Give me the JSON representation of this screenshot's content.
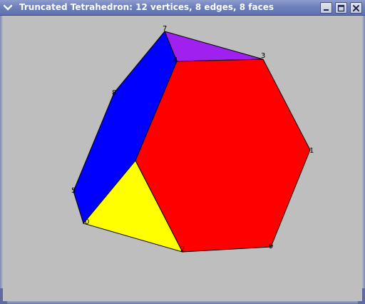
{
  "window": {
    "title": "Truncated Tetrahedron: 12 vertices, 8 edges, 8 faces",
    "menu_icon": "chevron-down-icon",
    "controls": {
      "minimize_icon": "minimize-icon",
      "maximize_icon": "maximize-icon",
      "close_icon": "close-icon"
    }
  },
  "colors": {
    "background": "#bebebe",
    "face_red": "#ff0000",
    "face_blue": "#0000ff",
    "face_yellow": "#ffff00",
    "face_purple": "#a020f0",
    "edge": "#000000"
  },
  "polyhedron": {
    "faces": [
      {
        "name": "purple-face",
        "color": "#a020f0"
      },
      {
        "name": "blue-face",
        "color": "#0000ff"
      },
      {
        "name": "yellow-face",
        "color": "#ffff00"
      },
      {
        "name": "red-face",
        "color": "#ff0000"
      }
    ],
    "vertex_labels": [
      "7",
      "3",
      "4",
      "8",
      "1",
      "5",
      "0",
      "2",
      "9"
    ]
  }
}
